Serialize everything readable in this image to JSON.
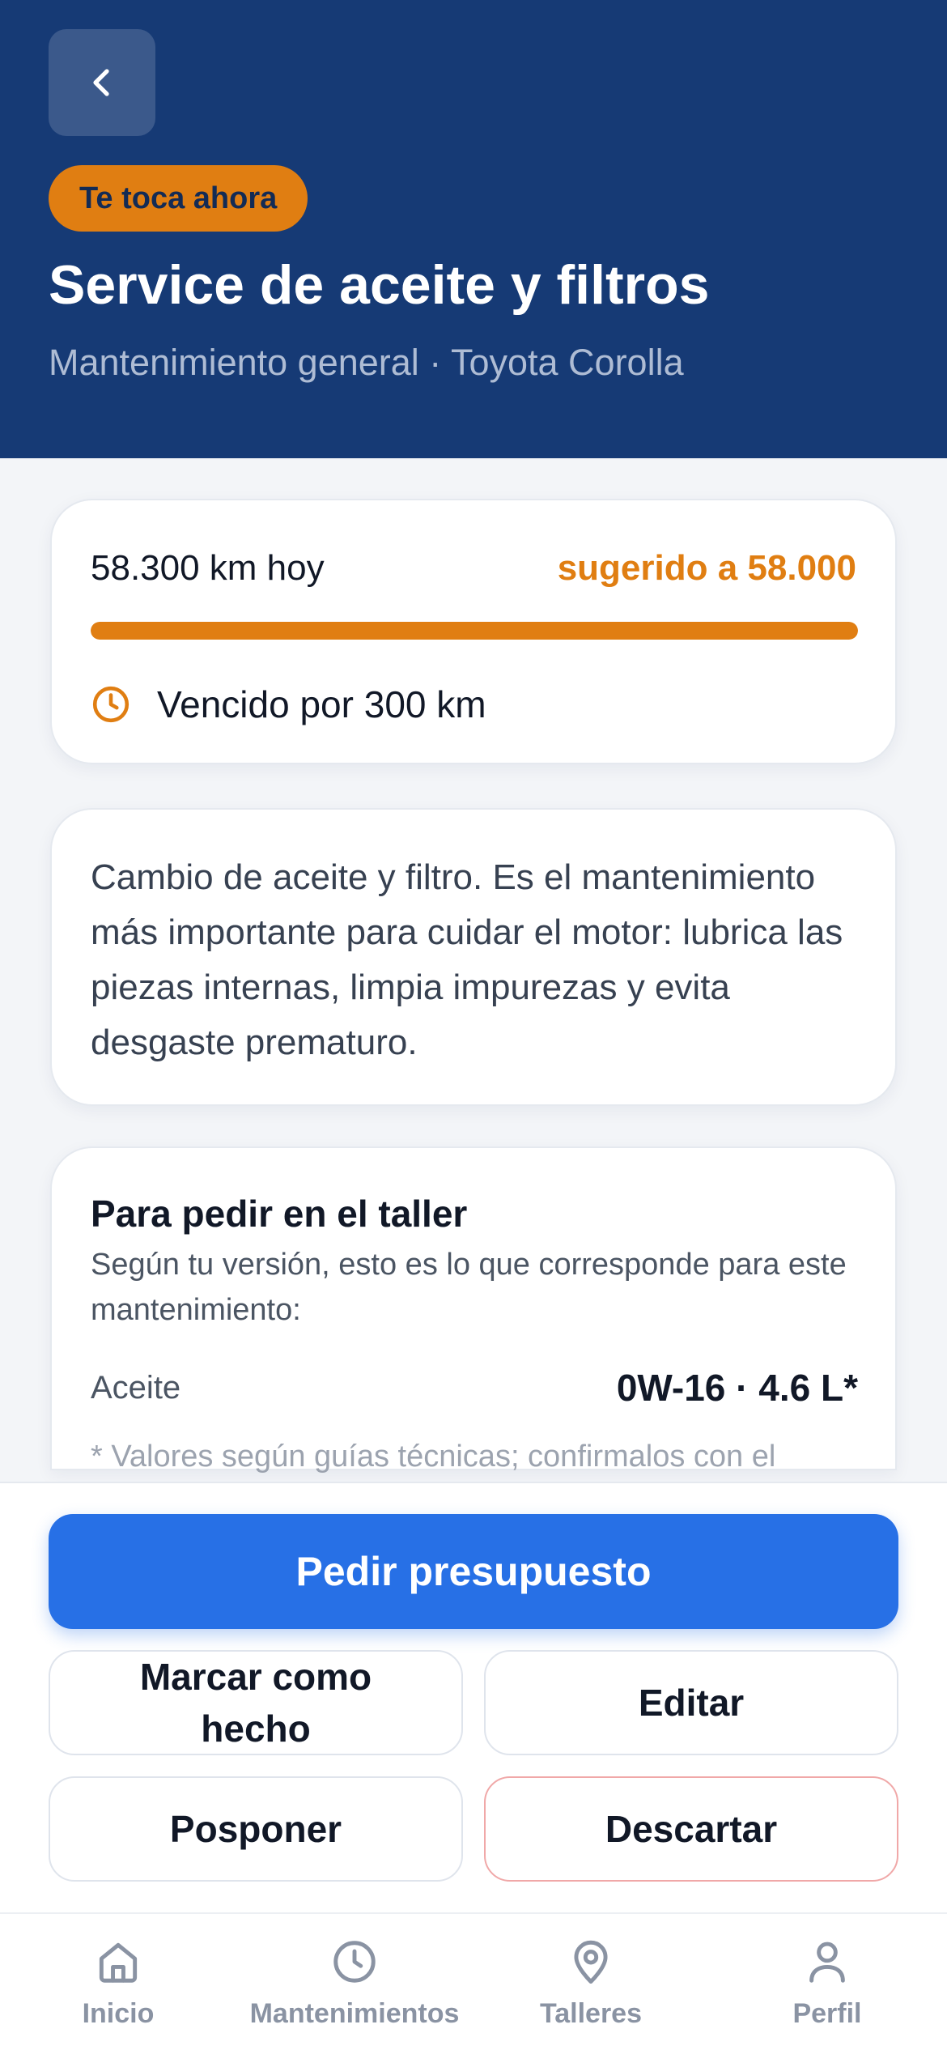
{
  "header": {
    "back_icon": "chevron-left-icon",
    "badge": "Te toca ahora",
    "title": "Service de aceite y filtros",
    "subtitle": "Mantenimiento general · Toyota Corolla"
  },
  "progress_card": {
    "km_today": "58.300 km hoy",
    "suggested": "sugerido a 58.000",
    "progress_fraction": 1.0,
    "status_icon": "clock-icon",
    "status_text": "Vencido por 300 km"
  },
  "description_card": {
    "text": "Cambio de aceite y filtro. Es el mantenimiento más importante para cuidar el motor: lubrica las piezas internas, limpia impurezas y evita desgaste prematuro."
  },
  "order_card": {
    "title": "Para pedir en el taller",
    "subtitle": "Según tu versión, esto es lo que corresponde para este mantenimiento:",
    "specs": [
      {
        "label": "Aceite",
        "value": "0W-16 · 4.6 L*"
      }
    ],
    "footnote": "* Valores según guías técnicas; confirmalos con el"
  },
  "actions": {
    "primary": "Pedir presupuesto",
    "mark_done": "Marcar como hecho",
    "edit": "Editar",
    "postpone": "Posponer",
    "discard": "Descartar"
  },
  "bottom_nav": {
    "items": [
      {
        "label": "Inicio",
        "icon": "home-icon"
      },
      {
        "label": "Mantenimientos",
        "icon": "clock-icon"
      },
      {
        "label": "Talleres",
        "icon": "map-pin-icon"
      },
      {
        "label": "Perfil",
        "icon": "user-icon"
      }
    ]
  },
  "colors": {
    "header_bg": "#163a75",
    "accent_orange": "#e07e12",
    "primary_blue": "#2770e6",
    "discard_border": "#f0a8a8"
  }
}
